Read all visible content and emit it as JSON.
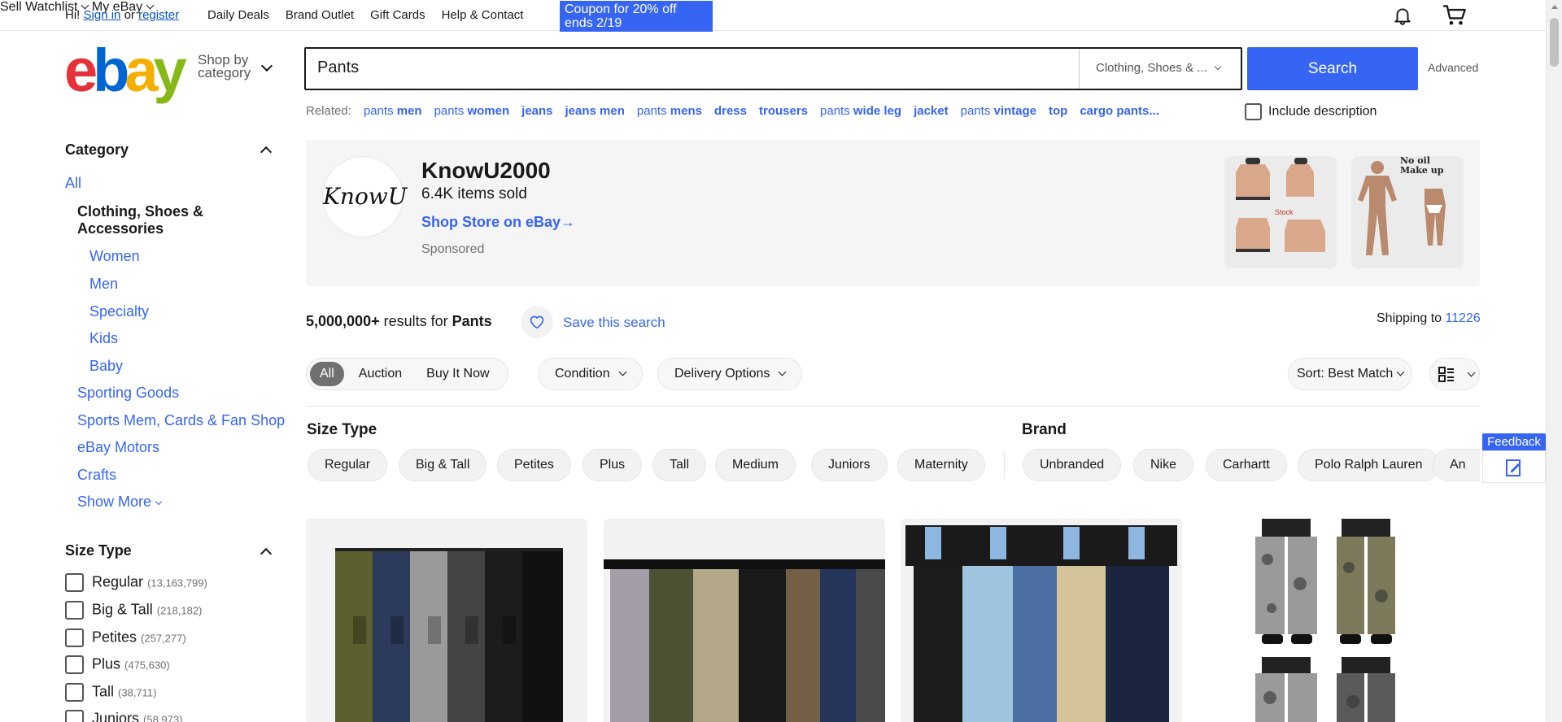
{
  "topbar": {
    "greeting_prefix": "Hi!",
    "sign_in": "Sign in",
    "or": "or",
    "register": "register",
    "links": [
      "Daily Deals",
      "Brand Outlet",
      "Gift Cards",
      "Help & Contact"
    ],
    "coupon": "Coupon for 20% off ends 2/19",
    "sell": "Sell",
    "watchlist": "Watchlist",
    "my_ebay": "My eBay"
  },
  "header": {
    "logo": [
      "e",
      "b",
      "a",
      "y"
    ],
    "shop_by_1": "Shop by",
    "shop_by_2": "category",
    "search_value": "Pants",
    "category_select": "Clothing, Shoes & ...",
    "search_button": "Search",
    "advanced": "Advanced"
  },
  "related": {
    "label": "Related:",
    "items": [
      {
        "plain": "pants ",
        "bold": "men"
      },
      {
        "plain": "pants ",
        "bold": "women"
      },
      {
        "plain": "",
        "bold": "jeans"
      },
      {
        "plain": "",
        "bold": "jeans men"
      },
      {
        "plain": "pants ",
        "bold": "mens"
      },
      {
        "plain": "",
        "bold": "dress"
      },
      {
        "plain": "",
        "bold": "trousers"
      },
      {
        "plain": "pants ",
        "bold": "wide leg"
      },
      {
        "plain": "",
        "bold": "jacket"
      },
      {
        "plain": "pants ",
        "bold": "vintage"
      },
      {
        "plain": "",
        "bold": "top"
      },
      {
        "plain": "cargo pants...",
        "bold": ""
      }
    ],
    "include_description": "Include description"
  },
  "sidebar": {
    "category_heading": "Category",
    "all": "All",
    "current": "Clothing, Shoes & Accessories",
    "subcategories": [
      "Women",
      "Men",
      "Specialty",
      "Kids",
      "Baby"
    ],
    "siblings": [
      "Sporting Goods",
      "Sports Mem, Cards & Fan Shop",
      "eBay Motors",
      "Crafts"
    ],
    "show_more": "Show More",
    "size_type_heading": "Size Type",
    "size_types": [
      {
        "label": "Regular",
        "count": "(13,163,799)"
      },
      {
        "label": "Big & Tall",
        "count": "(218,182)"
      },
      {
        "label": "Petites",
        "count": "(257,277)"
      },
      {
        "label": "Plus",
        "count": "(475,630)"
      },
      {
        "label": "Tall",
        "count": "(38,711)"
      },
      {
        "label": "Juniors",
        "count": "(58,973)"
      }
    ]
  },
  "ad": {
    "logo_text": "KnowU",
    "store_name": "KnowU2000",
    "items_sold": "6.4K items sold",
    "shop_link": "Shop Store on eBay",
    "sponsored": "Sponsored",
    "image1_text": "Stock",
    "image2_text_1": "No oil",
    "image2_text_2": "Make up"
  },
  "results": {
    "count": "5,000,000+",
    "results_for": "results for",
    "query": "Pants",
    "save_search": "Save this search",
    "shipping_to": "Shipping to",
    "zip": "11226"
  },
  "filters": {
    "tabs": [
      "All",
      "Auction",
      "Buy It Now"
    ],
    "condition": "Condition",
    "delivery": "Delivery Options",
    "sort": "Sort: Best Match"
  },
  "size_type_section": {
    "heading": "Size Type",
    "chips": [
      "Regular",
      "Big & Tall",
      "Petites",
      "Plus",
      "Tall",
      "Medium",
      "Juniors",
      "Maternity"
    ]
  },
  "brand_section": {
    "heading": "Brand",
    "chips": [
      "Unbranded",
      "Nike",
      "Carhartt",
      "Polo Ralph Lauren",
      "An"
    ]
  },
  "feedback": "Feedback",
  "colors": {
    "accent_blue": "#3665f3",
    "ebay_red": "#e53238",
    "ebay_blue": "#0064d2",
    "ebay_yellow": "#f5af02",
    "ebay_green": "#86b817"
  }
}
